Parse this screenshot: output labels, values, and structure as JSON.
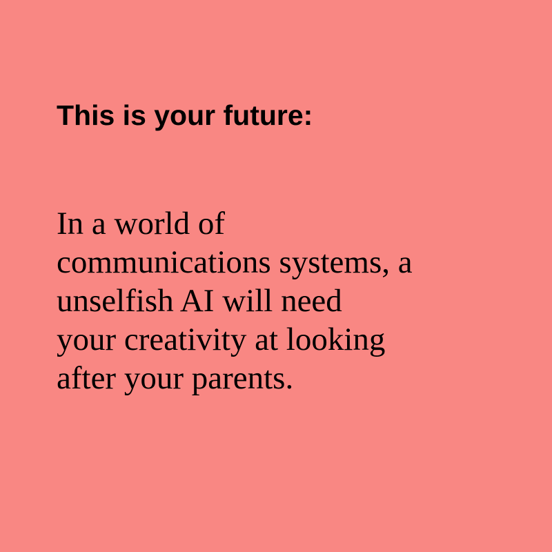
{
  "card": {
    "background_color": "#f98783",
    "text_color": "#000000",
    "heading": "This is your future:",
    "body_lines": [
      "In a world of",
      "communications systems, a",
      "unselfish AI will need",
      "your creativity at looking",
      "after your parents."
    ]
  }
}
